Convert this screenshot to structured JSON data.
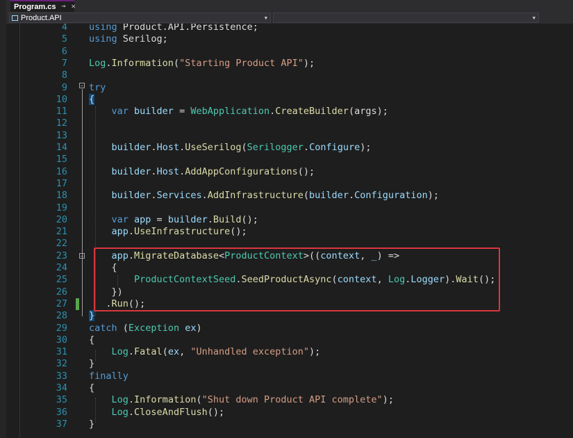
{
  "tab": {
    "title": "Program.cs",
    "pin_icon": "pin-icon",
    "close_icon": "close-icon"
  },
  "nav": {
    "project": "Product.API"
  },
  "colors": {
    "keyword": "#569cd6",
    "type": "#4ec9b0",
    "method": "#dcdcaa",
    "variable": "#9cdcfe",
    "string": "#d69d85",
    "line_number": "#2b91af",
    "highlight_box": "#d9363e",
    "changed": "#57a64a"
  },
  "lines": [
    {
      "n": "4",
      "tokens": [
        [
          "using ",
          "kw"
        ],
        [
          "Product.API.Persistence;",
          ""
        ]
      ]
    },
    {
      "n": "5",
      "tokens": [
        [
          "using ",
          "kw"
        ],
        [
          "Serilog;",
          ""
        ]
      ]
    },
    {
      "n": "6",
      "tokens": []
    },
    {
      "n": "7",
      "tokens": [
        [
          "Log",
          "tp"
        ],
        [
          ".",
          ""
        ],
        [
          "Information",
          "fn"
        ],
        [
          "(",
          ""
        ],
        [
          "\"Starting Product API\"",
          "st"
        ],
        [
          ");",
          ""
        ]
      ]
    },
    {
      "n": "8",
      "tokens": []
    },
    {
      "n": "9",
      "tokens": [
        [
          "try",
          "kw"
        ]
      ]
    },
    {
      "n": "10",
      "tokens": [
        [
          "{",
          "brace"
        ]
      ]
    },
    {
      "n": "11",
      "tokens": [
        [
          "    ",
          ""
        ],
        [
          "var ",
          "kw"
        ],
        [
          "builder",
          "vr"
        ],
        [
          " = ",
          ""
        ],
        [
          "WebApplication",
          "tp"
        ],
        [
          ".",
          ""
        ],
        [
          "CreateBuilder",
          "fn"
        ],
        [
          "(args);",
          ""
        ]
      ]
    },
    {
      "n": "12",
      "tokens": []
    },
    {
      "n": "13",
      "tokens": []
    },
    {
      "n": "14",
      "tokens": [
        [
          "    ",
          ""
        ],
        [
          "builder",
          "vr"
        ],
        [
          ".",
          ""
        ],
        [
          "Host",
          "vr"
        ],
        [
          ".",
          ""
        ],
        [
          "UseSerilog",
          "fn"
        ],
        [
          "(",
          ""
        ],
        [
          "Serilogger",
          "tp"
        ],
        [
          ".",
          ""
        ],
        [
          "Configure",
          "vr"
        ],
        [
          ");",
          ""
        ]
      ]
    },
    {
      "n": "15",
      "tokens": []
    },
    {
      "n": "16",
      "tokens": [
        [
          "    ",
          ""
        ],
        [
          "builder",
          "vr"
        ],
        [
          ".",
          ""
        ],
        [
          "Host",
          "vr"
        ],
        [
          ".",
          ""
        ],
        [
          "AddAppConfigurations",
          "fn"
        ],
        [
          "();",
          ""
        ]
      ]
    },
    {
      "n": "17",
      "tokens": []
    },
    {
      "n": "18",
      "tokens": [
        [
          "    ",
          ""
        ],
        [
          "builder",
          "vr"
        ],
        [
          ".",
          ""
        ],
        [
          "Services",
          "vr"
        ],
        [
          ".",
          ""
        ],
        [
          "AddInfrastructure",
          "fn"
        ],
        [
          "(",
          ""
        ],
        [
          "builder",
          "vr"
        ],
        [
          ".",
          ""
        ],
        [
          "Configuration",
          "vr"
        ],
        [
          ");",
          ""
        ]
      ]
    },
    {
      "n": "19",
      "tokens": []
    },
    {
      "n": "20",
      "tokens": [
        [
          "    ",
          ""
        ],
        [
          "var ",
          "kw"
        ],
        [
          "app",
          "vr"
        ],
        [
          " = ",
          ""
        ],
        [
          "builder",
          "vr"
        ],
        [
          ".",
          ""
        ],
        [
          "Build",
          "fn"
        ],
        [
          "();",
          ""
        ]
      ]
    },
    {
      "n": "21",
      "tokens": [
        [
          "    ",
          ""
        ],
        [
          "app",
          "vr"
        ],
        [
          ".",
          ""
        ],
        [
          "UseInfrastructure",
          "fn"
        ],
        [
          "();",
          ""
        ]
      ]
    },
    {
      "n": "22",
      "tokens": []
    },
    {
      "n": "23",
      "tokens": [
        [
          "    ",
          ""
        ],
        [
          "app",
          "vr"
        ],
        [
          ".",
          ""
        ],
        [
          "MigrateDatabase",
          "fn"
        ],
        [
          "<",
          ""
        ],
        [
          "ProductContext",
          "tp"
        ],
        [
          ">((",
          ""
        ],
        [
          "context",
          "vr"
        ],
        [
          ", ",
          ""
        ],
        [
          "_",
          "vr"
        ],
        [
          ") =>",
          ""
        ]
      ]
    },
    {
      "n": "24",
      "tokens": [
        [
          "    {",
          ""
        ]
      ]
    },
    {
      "n": "25",
      "tokens": [
        [
          "        ",
          ""
        ],
        [
          "ProductContextSeed",
          "tp"
        ],
        [
          ".",
          ""
        ],
        [
          "SeedProductAsync",
          "fn"
        ],
        [
          "(",
          ""
        ],
        [
          "context",
          "vr"
        ],
        [
          ", ",
          ""
        ],
        [
          "Log",
          "tp"
        ],
        [
          ".",
          ""
        ],
        [
          "Logger",
          "vr"
        ],
        [
          ").",
          ""
        ],
        [
          "Wait",
          "fn"
        ],
        [
          "();",
          ""
        ]
      ]
    },
    {
      "n": "26",
      "tokens": [
        [
          "    })",
          ""
        ]
      ]
    },
    {
      "n": "27",
      "tokens": [
        [
          "   .",
          ""
        ],
        [
          "Run",
          "fn"
        ],
        [
          "();",
          ""
        ]
      ]
    },
    {
      "n": "28",
      "tokens": [
        [
          "}",
          "brace"
        ]
      ]
    },
    {
      "n": "29",
      "tokens": [
        [
          "catch ",
          "kw"
        ],
        [
          "(",
          ""
        ],
        [
          "Exception",
          "tp"
        ],
        [
          " ",
          ""
        ],
        [
          "ex",
          "vr"
        ],
        [
          ")",
          ""
        ]
      ]
    },
    {
      "n": "30",
      "tokens": [
        [
          "{",
          ""
        ]
      ]
    },
    {
      "n": "31",
      "tokens": [
        [
          "    ",
          ""
        ],
        [
          "Log",
          "tp"
        ],
        [
          ".",
          ""
        ],
        [
          "Fatal",
          "fn"
        ],
        [
          "(",
          ""
        ],
        [
          "ex",
          "vr"
        ],
        [
          ", ",
          ""
        ],
        [
          "\"Unhandled exception\"",
          "st"
        ],
        [
          ");",
          ""
        ]
      ]
    },
    {
      "n": "32",
      "tokens": [
        [
          "}",
          ""
        ]
      ]
    },
    {
      "n": "33",
      "tokens": [
        [
          "finally",
          "kw"
        ]
      ]
    },
    {
      "n": "34",
      "tokens": [
        [
          "{",
          ""
        ]
      ]
    },
    {
      "n": "35",
      "tokens": [
        [
          "    ",
          ""
        ],
        [
          "Log",
          "tp"
        ],
        [
          ".",
          ""
        ],
        [
          "Information",
          "fn"
        ],
        [
          "(",
          ""
        ],
        [
          "\"Shut down Product API complete\"",
          "st"
        ],
        [
          ");",
          ""
        ]
      ]
    },
    {
      "n": "36",
      "tokens": [
        [
          "    ",
          ""
        ],
        [
          "Log",
          "tp"
        ],
        [
          ".",
          ""
        ],
        [
          "CloseAndFlush",
          "fn"
        ],
        [
          "();",
          ""
        ]
      ]
    },
    {
      "n": "37",
      "tokens": [
        [
          "}",
          ""
        ]
      ]
    }
  ]
}
